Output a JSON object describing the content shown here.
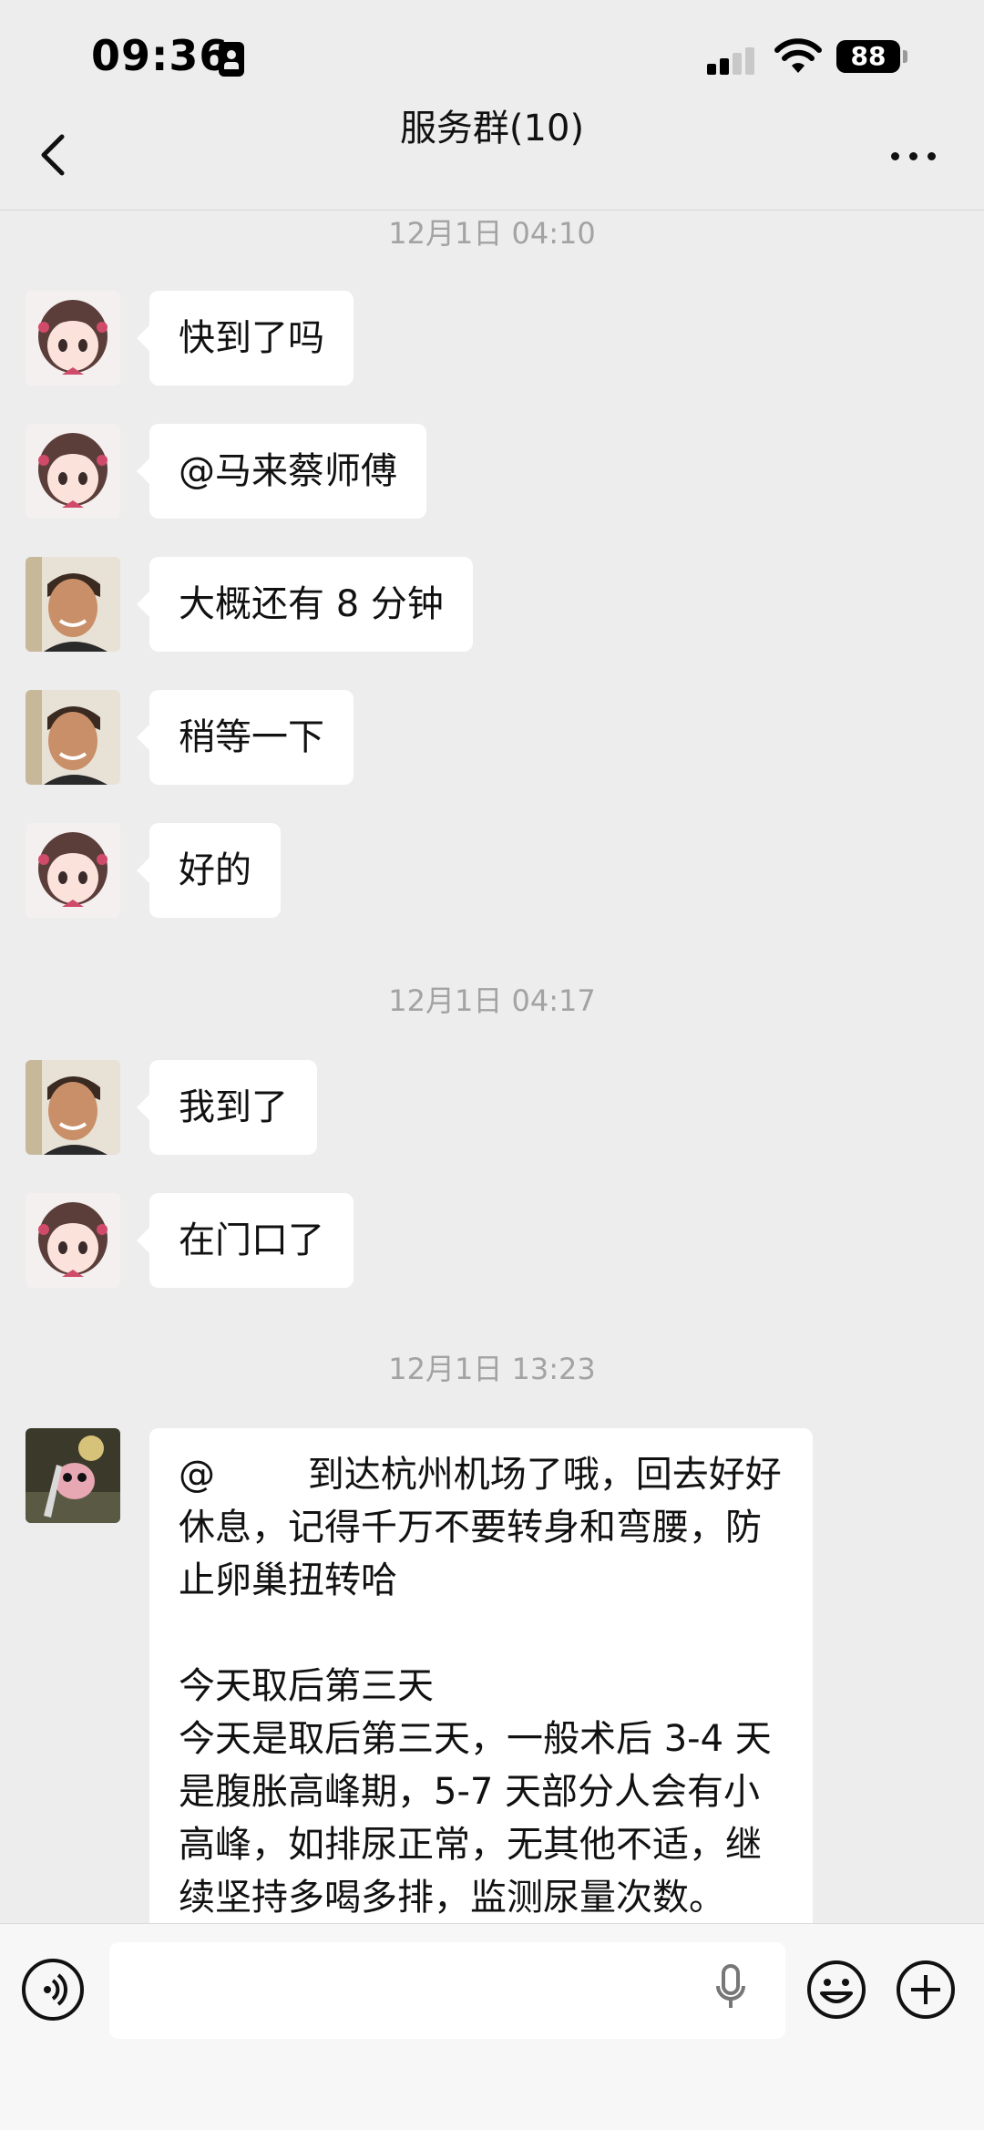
{
  "status_bar": {
    "time": "09:36",
    "battery": "88"
  },
  "header": {
    "title": "服务群(10)"
  },
  "messages": [
    {
      "timestamp": "12月1日 04:10"
    },
    {
      "sender": "girl-avatar",
      "text": "快到了吗"
    },
    {
      "sender": "girl-avatar",
      "text": "@马来蔡师傅"
    },
    {
      "sender": "man-avatar",
      "text": "大概还有 8 分钟"
    },
    {
      "sender": "man-avatar",
      "text": "稍等一下"
    },
    {
      "sender": "girl-avatar",
      "text": "好的"
    },
    {
      "timestamp": "12月1日 04:17"
    },
    {
      "sender": "man-avatar",
      "text": "我到了"
    },
    {
      "sender": "girl-avatar",
      "text": "在门口了"
    },
    {
      "timestamp": "12月1日 13:23"
    },
    {
      "sender": "bird-avatar",
      "text": "@        到达杭州机场了哦，回去好好休息，记得千万不要转身和弯腰，防止卵巢扭转哈\n\n今天取后第三天\n今天是取后第三天，一般术后 3-4 天是腹胀高峰期，5-7 天部分人会有小高峰，如排尿正常，无其他不适，继续坚持多喝多排，监测尿量次数。"
    }
  ],
  "input": {
    "placeholder": ""
  },
  "colors": {
    "background": "#ededed",
    "bubble": "#ffffff",
    "timestamp": "#a3a3a3",
    "input_bar": "#f7f7f7"
  },
  "icons": [
    "back-chevron-icon",
    "more-dots-icon",
    "voice-icon",
    "microphone-icon",
    "emoji-icon",
    "plus-icon"
  ]
}
